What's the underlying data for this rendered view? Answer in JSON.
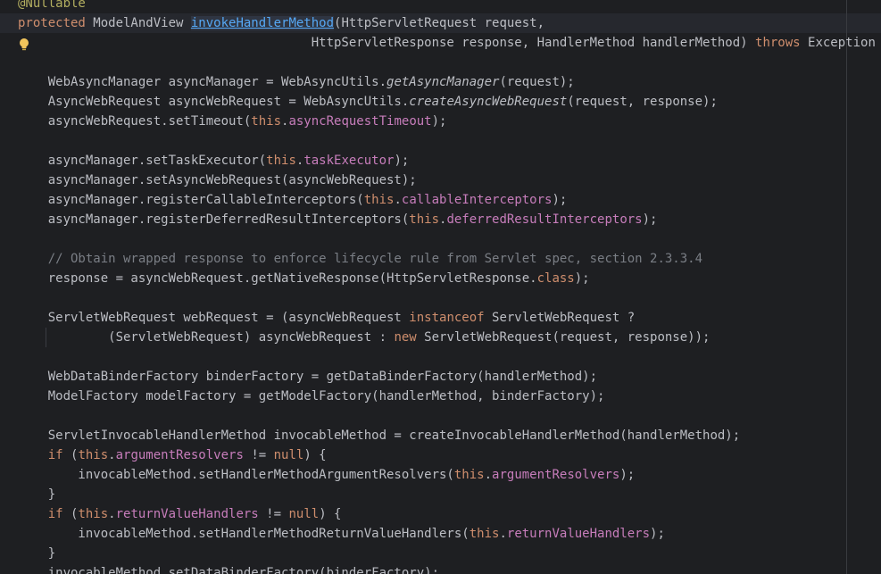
{
  "editor": {
    "lines": [
      [
        {
          "t": "@Nullable",
          "c": "ann"
        }
      ],
      [
        {
          "t": "protected",
          "c": "kw"
        },
        {
          "t": " ModelAndView "
        },
        {
          "t": "invokeHandlerMethod",
          "c": "mdecl usage"
        },
        {
          "t": "(HttpServletRequest request,"
        }
      ],
      [
        {
          "t": "                                       HttpServletResponse response, HandlerMethod handlerMethod) "
        },
        {
          "t": "throws",
          "c": "kw"
        },
        {
          "t": " Exception {"
        }
      ],
      [],
      [
        {
          "t": "    WebAsyncManager asyncManager = WebAsyncUtils."
        },
        {
          "t": "getAsyncManager",
          "c": "st"
        },
        {
          "t": "(request);"
        }
      ],
      [
        {
          "t": "    AsyncWebRequest asyncWebRequest = WebAsyncUtils."
        },
        {
          "t": "createAsyncWebRequest",
          "c": "st"
        },
        {
          "t": "(request, response);"
        }
      ],
      [
        {
          "t": "    asyncWebRequest.setTimeout("
        },
        {
          "t": "this",
          "c": "kw"
        },
        {
          "t": "."
        },
        {
          "t": "asyncRequestTimeout",
          "c": "fld"
        },
        {
          "t": ");"
        }
      ],
      [],
      [
        {
          "t": "    asyncManager.setTaskExecutor("
        },
        {
          "t": "this",
          "c": "kw"
        },
        {
          "t": "."
        },
        {
          "t": "taskExecutor",
          "c": "fld"
        },
        {
          "t": ");"
        }
      ],
      [
        {
          "t": "    asyncManager.setAsyncWebRequest(asyncWebRequest);"
        }
      ],
      [
        {
          "t": "    asyncManager.registerCallableInterceptors("
        },
        {
          "t": "this",
          "c": "kw"
        },
        {
          "t": "."
        },
        {
          "t": "callableInterceptors",
          "c": "fld"
        },
        {
          "t": ");"
        }
      ],
      [
        {
          "t": "    asyncManager.registerDeferredResultInterceptors("
        },
        {
          "t": "this",
          "c": "kw"
        },
        {
          "t": "."
        },
        {
          "t": "deferredResultInterceptors",
          "c": "fld"
        },
        {
          "t": ");"
        }
      ],
      [],
      [
        {
          "t": "    // Obtain wrapped response to enforce lifecycle rule from Servlet spec, section 2.3.3.4",
          "c": "cmt"
        }
      ],
      [
        {
          "t": "    response = asyncWebRequest.getNativeResponse(HttpServletResponse."
        },
        {
          "t": "class",
          "c": "kw"
        },
        {
          "t": ");"
        }
      ],
      [],
      [
        {
          "t": "    ServletWebRequest webRequest = (asyncWebRequest "
        },
        {
          "t": "instanceof",
          "c": "kw"
        },
        {
          "t": " ServletWebRequest ?"
        }
      ],
      [
        {
          "t": "            (ServletWebRequest) asyncWebRequest : "
        },
        {
          "t": "new",
          "c": "kw"
        },
        {
          "t": " ServletWebRequest(request, response));"
        }
      ],
      [],
      [
        {
          "t": "    WebDataBinderFactory binderFactory = getDataBinderFactory(handlerMethod);"
        }
      ],
      [
        {
          "t": "    ModelFactory modelFactory = getModelFactory(handlerMethod, binderFactory);"
        }
      ],
      [],
      [
        {
          "t": "    ServletInvocableHandlerMethod invocableMethod = createInvocableHandlerMethod(handlerMethod);"
        }
      ],
      [
        {
          "t": "    "
        },
        {
          "t": "if",
          "c": "kw"
        },
        {
          "t": " ("
        },
        {
          "t": "this",
          "c": "kw"
        },
        {
          "t": "."
        },
        {
          "t": "argumentResolvers",
          "c": "fld"
        },
        {
          "t": " != "
        },
        {
          "t": "null",
          "c": "kw"
        },
        {
          "t": ") {"
        }
      ],
      [
        {
          "t": "        invocableMethod.setHandlerMethodArgumentResolvers("
        },
        {
          "t": "this",
          "c": "kw"
        },
        {
          "t": "."
        },
        {
          "t": "argumentResolvers",
          "c": "fld"
        },
        {
          "t": ");"
        }
      ],
      [
        {
          "t": "    }"
        }
      ],
      [
        {
          "t": "    "
        },
        {
          "t": "if",
          "c": "kw"
        },
        {
          "t": " ("
        },
        {
          "t": "this",
          "c": "kw"
        },
        {
          "t": "."
        },
        {
          "t": "returnValueHandlers",
          "c": "fld"
        },
        {
          "t": " != "
        },
        {
          "t": "null",
          "c": "kw"
        },
        {
          "t": ") {"
        }
      ],
      [
        {
          "t": "        invocableMethod.setHandlerMethodReturnValueHandlers("
        },
        {
          "t": "this",
          "c": "kw"
        },
        {
          "t": "."
        },
        {
          "t": "returnValueHandlers",
          "c": "fld"
        },
        {
          "t": ");"
        }
      ],
      [
        {
          "t": "    }"
        }
      ],
      [
        {
          "t": "    invocableMethod.setDataBinderFactory(binderFactory);"
        }
      ]
    ]
  },
  "gutter": {
    "intention_icon": "lightbulb-icon"
  },
  "colors": {
    "background": "#1e1f22",
    "text": "#bcbec4",
    "keyword": "#cf8e6d",
    "annotation": "#b3ae60",
    "field": "#c77dbb",
    "comment": "#7a7e85",
    "method_declaration": "#56a8f5",
    "intention_bulb": "#f2c55c"
  }
}
